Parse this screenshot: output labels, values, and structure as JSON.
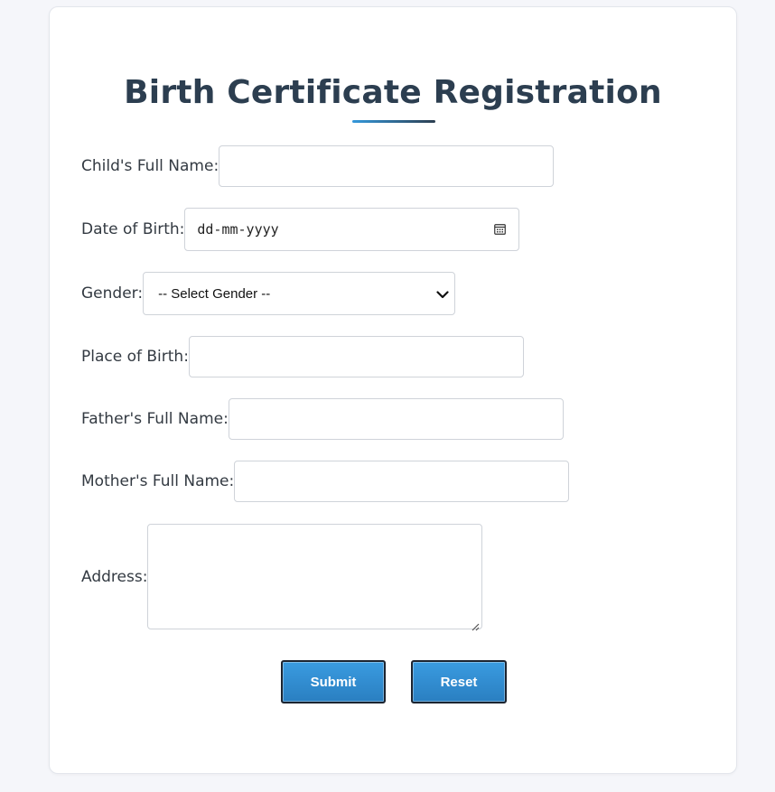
{
  "form": {
    "title": "Birth Certificate Registration",
    "accent_color": "#3498db",
    "title_color": "#2c3e50",
    "fields": {
      "child_name": {
        "label": "Child's Full Name:",
        "value": ""
      },
      "dob": {
        "label": "Date of Birth:",
        "placeholder": "dd-mm-yyyy",
        "icon": "calendar-icon"
      },
      "gender": {
        "label": "Gender:",
        "selected": "-- Select Gender --",
        "icon": "chevron-down-icon"
      },
      "place": {
        "label": "Place of Birth:",
        "value": ""
      },
      "father": {
        "label": "Father's Full Name:",
        "value": ""
      },
      "mother": {
        "label": "Mother's Full Name:",
        "value": ""
      },
      "address": {
        "label": "Address:",
        "value": ""
      }
    },
    "buttons": {
      "submit": "Submit",
      "reset": "Reset"
    }
  }
}
